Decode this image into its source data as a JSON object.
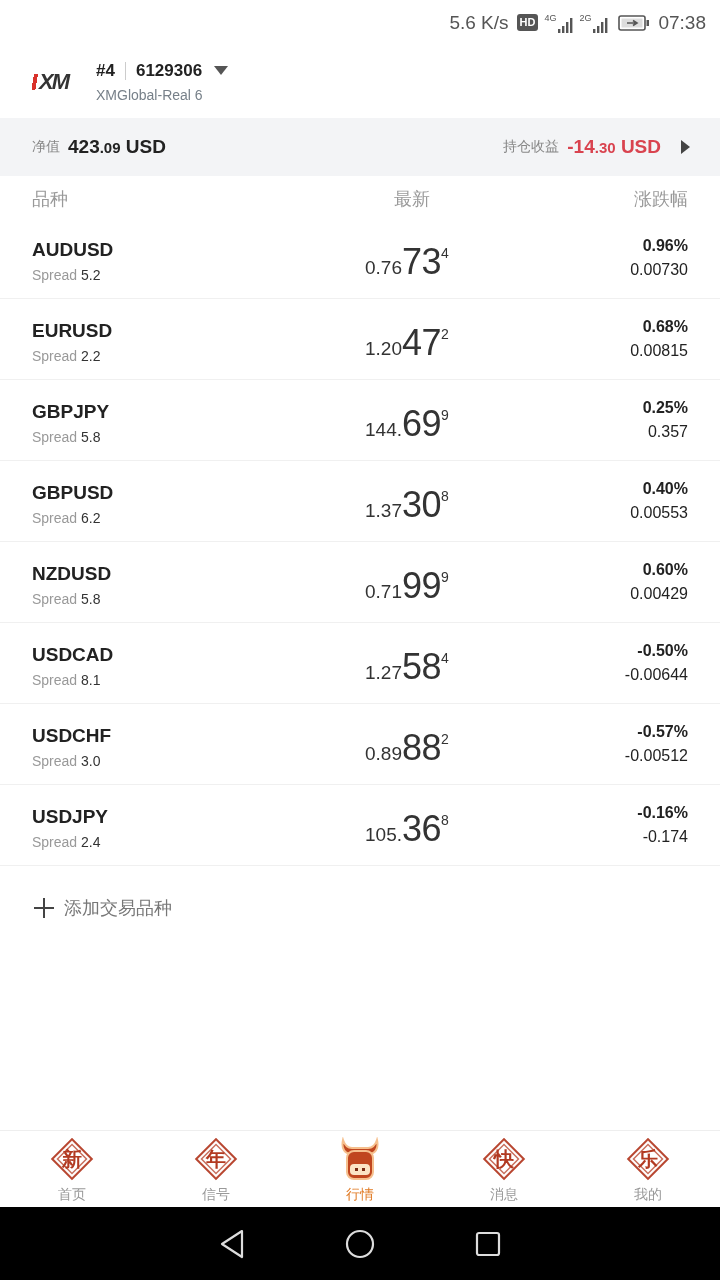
{
  "status_bar": {
    "net_speed": "5.6 K/s",
    "hd_badge": "HD",
    "sim1_network": "4G",
    "sim2_network": "2G",
    "time": "07:38"
  },
  "account": {
    "logo_text": "XM",
    "number": "#4",
    "login": "6129306",
    "server": "XMGlobal-Real 6"
  },
  "summary": {
    "equity_label": "净值",
    "equity": {
      "whole": "423",
      "fraction": ".09",
      "currency": "USD"
    },
    "profit_label": "持仓收益",
    "profit": {
      "whole": "-14",
      "fraction": ".30",
      "currency": "USD"
    }
  },
  "columns": [
    "品种",
    "最新",
    "涨跌幅"
  ],
  "quotes": [
    {
      "symbol": "AUDUSD",
      "spread_label": "Spread",
      "spread": "5.2",
      "price": {
        "lead": "0.76",
        "big": "73",
        "pip": "4"
      },
      "change_pct": "0.96%",
      "change": "0.00730"
    },
    {
      "symbol": "EURUSD",
      "spread_label": "Spread",
      "spread": "2.2",
      "price": {
        "lead": "1.20",
        "big": "47",
        "pip": "2"
      },
      "change_pct": "0.68%",
      "change": "0.00815"
    },
    {
      "symbol": "GBPJPY",
      "spread_label": "Spread",
      "spread": "5.8",
      "price": {
        "lead": "144.",
        "big": "69",
        "pip": "9"
      },
      "change_pct": "0.25%",
      "change": "0.357"
    },
    {
      "symbol": "GBPUSD",
      "spread_label": "Spread",
      "spread": "6.2",
      "price": {
        "lead": "1.37",
        "big": "30",
        "pip": "8"
      },
      "change_pct": "0.40%",
      "change": "0.00553"
    },
    {
      "symbol": "NZDUSD",
      "spread_label": "Spread",
      "spread": "5.8",
      "price": {
        "lead": "0.71",
        "big": "99",
        "pip": "9"
      },
      "change_pct": "0.60%",
      "change": "0.00429"
    },
    {
      "symbol": "USDCAD",
      "spread_label": "Spread",
      "spread": "8.1",
      "price": {
        "lead": "1.27",
        "big": "58",
        "pip": "4"
      },
      "change_pct": "-0.50%",
      "change": "-0.00644"
    },
    {
      "symbol": "USDCHF",
      "spread_label": "Spread",
      "spread": "3.0",
      "price": {
        "lead": "0.89",
        "big": "88",
        "pip": "2"
      },
      "change_pct": "-0.57%",
      "change": "-0.00512"
    },
    {
      "symbol": "USDJPY",
      "spread_label": "Spread",
      "spread": "2.4",
      "price": {
        "lead": "105.",
        "big": "36",
        "pip": "8"
      },
      "change_pct": "-0.16%",
      "change": "-0.174"
    }
  ],
  "add_symbol": {
    "label": "添加交易品种"
  },
  "tabs": [
    {
      "label": "首页",
      "kind": "seal",
      "glyph": "新",
      "selected": false
    },
    {
      "label": "信号",
      "kind": "seal",
      "glyph": "年",
      "selected": false
    },
    {
      "label": "行情",
      "kind": "bull",
      "selected": true
    },
    {
      "label": "消息",
      "kind": "seal",
      "glyph": "快",
      "selected": false
    },
    {
      "label": "我的",
      "kind": "seal",
      "glyph": "乐",
      "selected": false
    }
  ]
}
